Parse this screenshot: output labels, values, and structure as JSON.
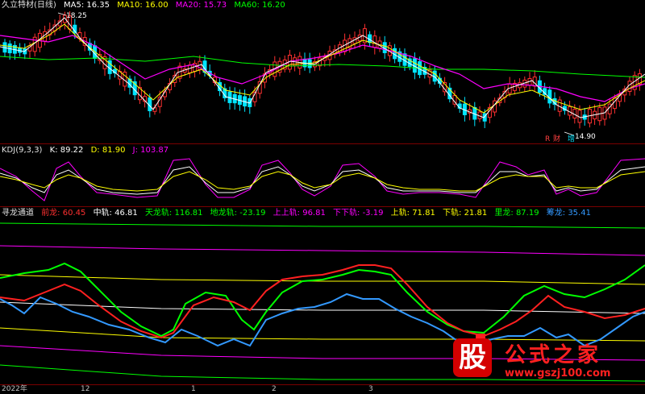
{
  "main_panel": {
    "title": "久立特材(日线)",
    "ma5": "MA5: 16.35",
    "ma10": "MA10: 16.00",
    "ma20": "MA20: 15.73",
    "ma60": "MA60: 16.20",
    "high_label": "18.25",
    "low_label": "14.90",
    "marker_cai": "财",
    "marker_zeng": "增",
    "marker_r": "R",
    "colors": {
      "ma5": "#ffffff",
      "ma10": "#ffff00",
      "ma20": "#ff00ff",
      "ma60": "#00ff00",
      "up": "#ff3030",
      "down": "#00e5ff"
    }
  },
  "kdj_panel": {
    "title": "KDJ(9,3,3)",
    "k": "K: 89.22",
    "d": "D: 81.90",
    "j": "J: 103.87"
  },
  "xunlong_panel": {
    "title": "寻龙通道",
    "qianlong": "前龙: 60.45",
    "zhonggui": "中轨: 46.81",
    "tianlonggui": "天龙轨: 116.81",
    "dilonggui": "地龙轨: -23.19",
    "shangshanggui": "上上轨: 96.81",
    "xiaxiagui": "下下轨: -3.19",
    "shanggui": "上轨: 71.81",
    "xiagui": "下轨: 21.81",
    "lilong": "里龙: 87.19",
    "choulong": "筹龙: 35.41"
  },
  "x_axis": {
    "d2022": "2022年",
    "d12": "12",
    "d1": "1",
    "d2": "2",
    "d3": "3"
  },
  "watermark": {
    "gu": "股",
    "site_name": "公式之家",
    "url": "www.gszj100.com"
  }
}
